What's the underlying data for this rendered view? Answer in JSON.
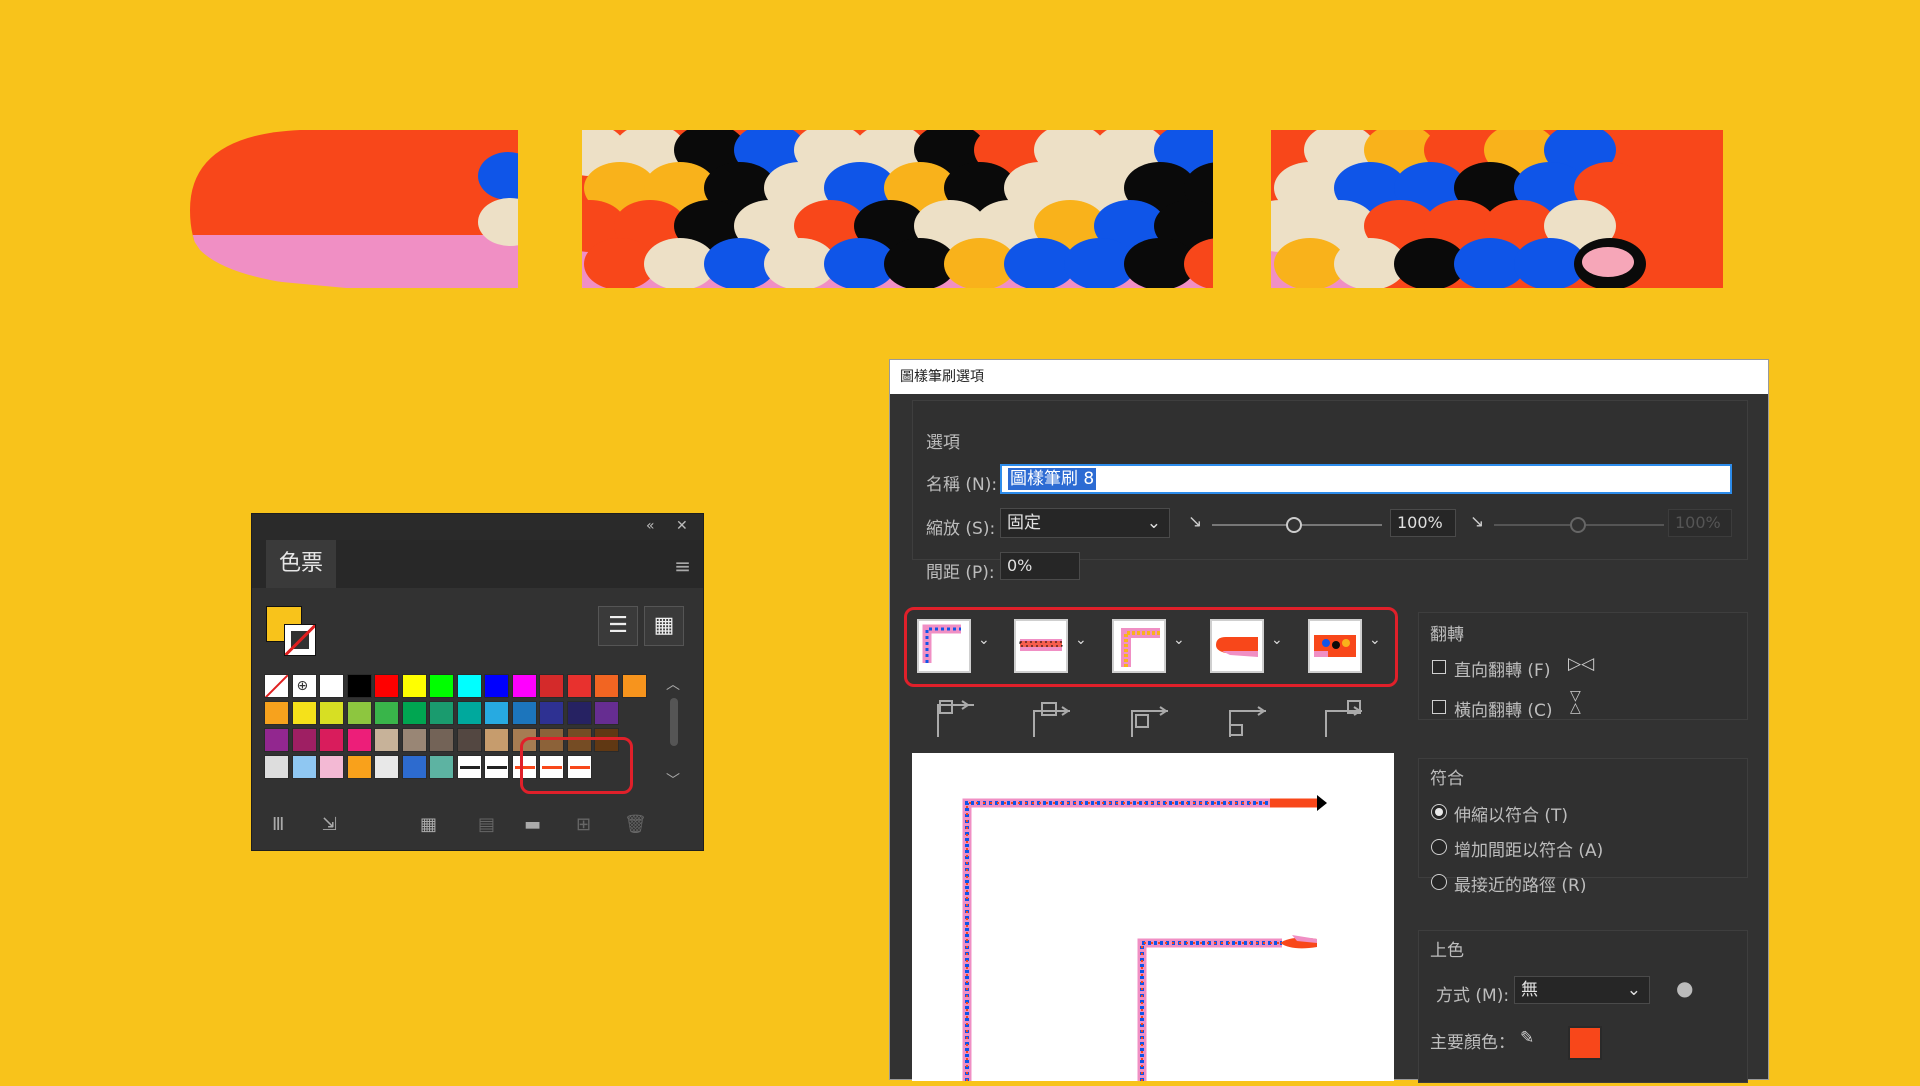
{
  "swatches_panel": {
    "tab_label": "色票",
    "collapse_icon": "double-chevron-left-icon",
    "close_icon": "close-icon",
    "menu_icon": "hamburger-menu-icon",
    "list_view_icon": "list-view-icon",
    "grid_view_icon": "grid-view-icon",
    "fill_color": "#f8c31b",
    "bottom_icons": [
      "swatch-libraries-icon",
      "place-swatches-icon",
      "swatch-options-icon",
      "new-color-group-icon",
      "new-folder-icon",
      "new-swatch-icon",
      "delete-icon"
    ],
    "swatch_rows": [
      [
        "none",
        "registration",
        "#ffffff",
        "#000000",
        "#ff0000",
        "#ffff00",
        "#00ff00",
        "#00ffff",
        "#0000ff",
        "#ff00ff",
        "#d42a2a",
        "#e8312e",
        "#f26522",
        "#f7941d"
      ],
      [
        "#f7a21d",
        "#f5e11a",
        "#d7df23",
        "#8dc63f",
        "#39b54a",
        "#00a651",
        "#1a9b6e",
        "#00a99d",
        "#27aae1",
        "#1c75bc",
        "#2e3192",
        "#262262",
        "#662d91"
      ],
      [
        "#92278f",
        "#9e1f63",
        "#d91c5c",
        "#ed1e79",
        "#c7b299",
        "#998675",
        "#736357",
        "#534741",
        "#c69c6d",
        "#a67c52",
        "#8c6239",
        "#754c24",
        "#603813"
      ]
    ]
  },
  "dialog": {
    "title": "圖樣筆刷選項",
    "options_group": "選項",
    "name_label": "名稱 (N):",
    "name_value": "圖樣筆刷 8",
    "scale_label": "縮放 (S):",
    "scale_value": "固定",
    "scale_percent": "100%",
    "scale_percent_disabled": "100%",
    "spacing_label": "間距 (P):",
    "spacing_value": "0%",
    "flip_group": "翻轉",
    "flip_vertical": "直向翻轉 (F)",
    "flip_horizontal": "橫向翻轉 (C)",
    "fit_group": "符合",
    "fit_options": [
      "伸縮以符合 (T)",
      "增加間距以符合 (A)",
      "最接近的路徑 (R)"
    ],
    "fit_selected": 0,
    "color_group": "上色",
    "method_label": "方式 (M):",
    "method_value": "無",
    "key_color_label": "主要顏色：",
    "key_color": "#f8471a",
    "tile_icons": [
      "outer-corner-tile-icon",
      "side-tile-icon",
      "inner-corner-tile-icon",
      "start-tile-icon",
      "end-tile-icon"
    ],
    "corner_icons": [
      "outer-corner-icon",
      "side-icon",
      "inner-corner-icon",
      "start-icon",
      "end-icon"
    ]
  },
  "colors": {
    "background": "#f8c31b",
    "orange": "#f8471a",
    "pink": "#f08fc4",
    "blue": "#0f55e8",
    "cream": "#ede0c6",
    "black": "#0a0a0a",
    "gold": "#f9b21b"
  }
}
